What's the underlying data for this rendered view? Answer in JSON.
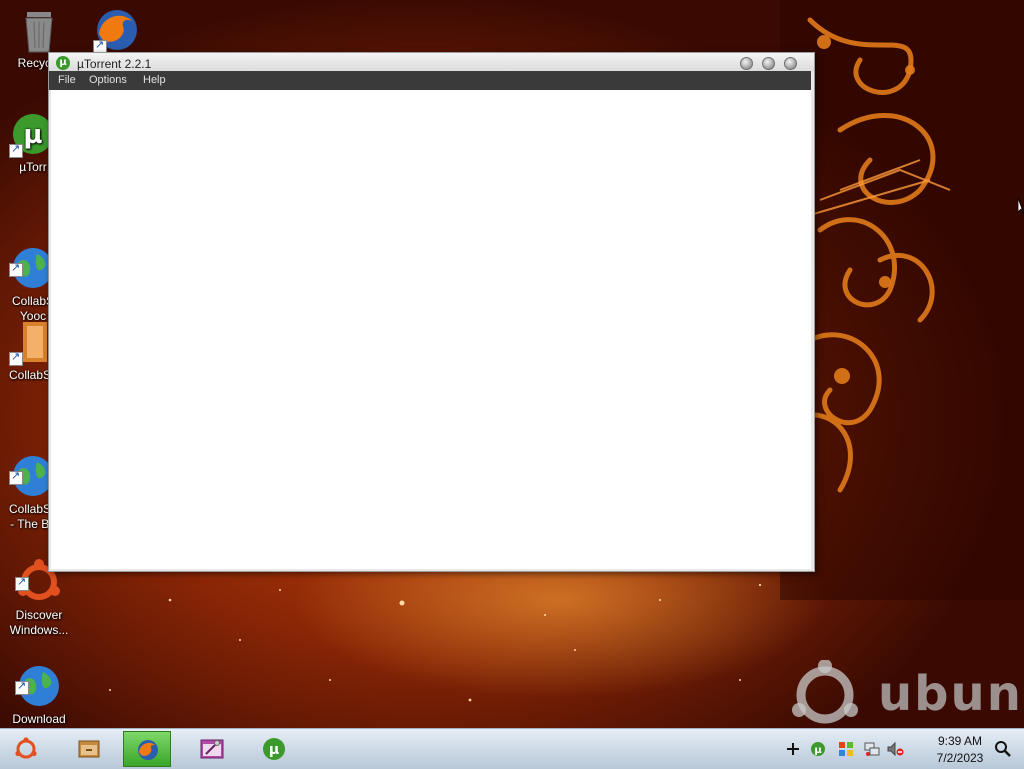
{
  "desktop": {
    "icons": [
      {
        "label": "Recycle"
      },
      {
        "label": ""
      },
      {
        "label": "µTorr"
      },
      {
        "label": "CollabS\nYooc"
      },
      {
        "label": "CollabSy"
      },
      {
        "label": "CollabSy\n- The Be"
      },
      {
        "label": "Discover\nWindows..."
      },
      {
        "label": "Download\nMore Colla..."
      }
    ],
    "watermark": "ubun"
  },
  "window": {
    "title": "µTorrent 2.2.1",
    "menu": [
      "File",
      "Options",
      "Help"
    ]
  },
  "taskbar": {
    "buttons": [
      {
        "name": "ubuntu-start-icon"
      },
      {
        "name": "file-manager-icon"
      },
      {
        "name": "firefox-icon",
        "active": true
      },
      {
        "name": "control-panel-icon"
      },
      {
        "name": "utorrent-icon"
      }
    ],
    "tray": {
      "icons": [
        "plus-icon",
        "utorrent-tray-icon",
        "windows-flag-icon",
        "network-icon",
        "volume-muted-icon"
      ]
    },
    "clock": {
      "time": "9:39 AM",
      "date": "7/2/2023"
    }
  },
  "colors": {
    "utorrent_green": "#3b9a2b",
    "menubar": "#3a3a3a",
    "taskbar_active": "#3aa52a"
  }
}
